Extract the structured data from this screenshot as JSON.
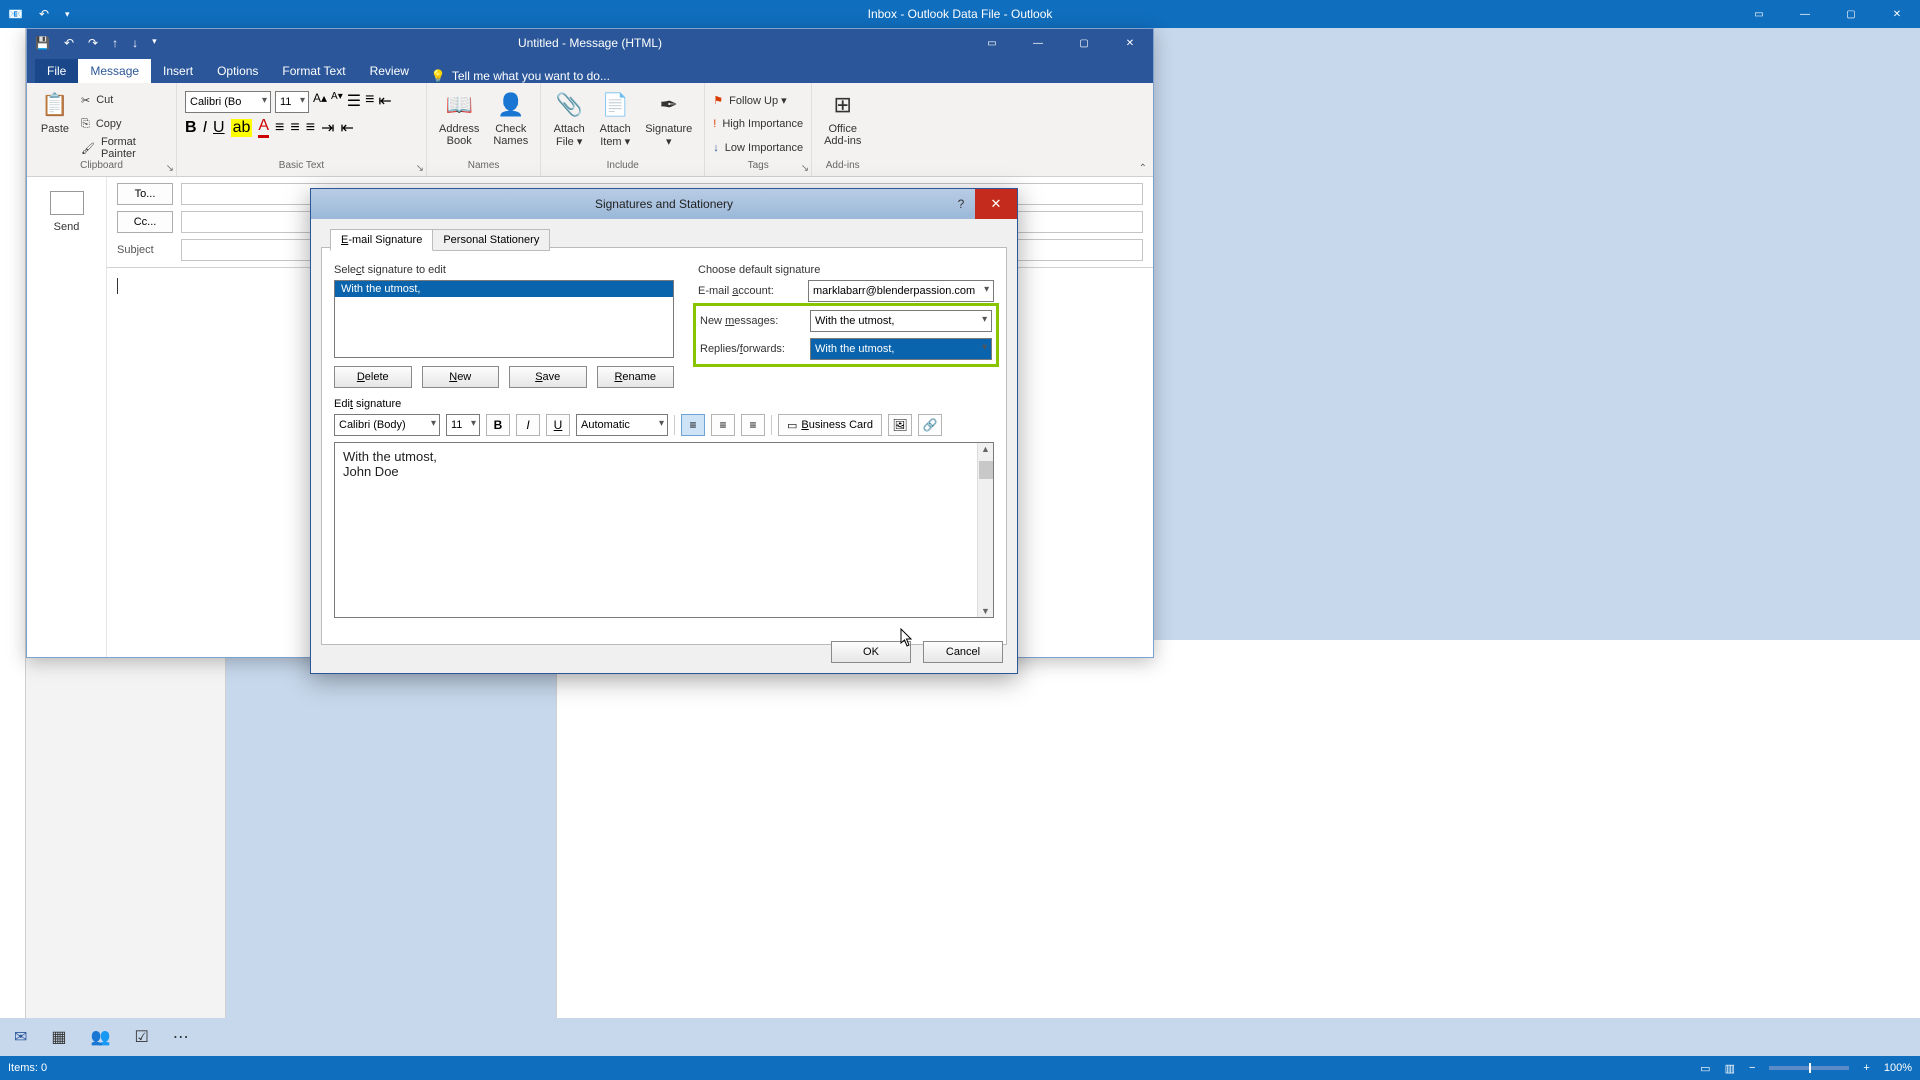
{
  "main_window": {
    "title": "Inbox - Outlook Data File - Outlook",
    "status_items": "Items: 0",
    "zoom": "100%"
  },
  "msg_window": {
    "title": "Untitled - Message (HTML)",
    "tabs": {
      "file": "File",
      "message": "Message",
      "insert": "Insert",
      "options": "Options",
      "format": "Format Text",
      "review": "Review",
      "tell": "Tell me what you want to do..."
    },
    "ribbon": {
      "paste": "Paste",
      "cut": "Cut",
      "copy": "Copy",
      "fmt_painter": "Format Painter",
      "clipboard": "Clipboard",
      "basic_text": "Basic Text",
      "names": "Names",
      "include": "Include",
      "tags": "Tags",
      "addins": "Add-ins",
      "font": "Calibri (Bo",
      "size": "11",
      "addr_book": "Address\nBook",
      "check_names": "Check\nNames",
      "attach_file": "Attach\nFile ▾",
      "attach_item": "Attach\nItem ▾",
      "signature": "Signature\n▾",
      "follow_up": "Follow Up ▾",
      "high_imp": "High Importance",
      "low_imp": "Low Importance",
      "office_addins": "Office\nAdd-ins"
    },
    "compose": {
      "send": "Send",
      "to": "To...",
      "cc": "Cc...",
      "subject": "Subject"
    }
  },
  "dialog": {
    "title": "Signatures and Stationery",
    "tabs": {
      "email": "E-mail Signature",
      "personal": "Personal Stationery"
    },
    "select_label": "Select signature to edit",
    "choose_label": "Choose default signature",
    "sig_list": [
      "With the utmost,"
    ],
    "defaults": {
      "email_account_label": "E-mail account:",
      "email_account": "marklabarr@blenderpassion.com",
      "new_msg_label": "New messages:",
      "new_msg": "With the utmost,",
      "replies_label": "Replies/forwards:",
      "replies": "With the utmost,"
    },
    "btns": {
      "delete": "Delete",
      "new": "New",
      "save": "Save",
      "rename": "Rename",
      "ok": "OK",
      "cancel": "Cancel"
    },
    "edit_label": "Edit signature",
    "edit_toolbar": {
      "font": "Calibri (Body)",
      "size": "11",
      "color": "Automatic",
      "bizcard": "Business Card"
    },
    "edit_text_l1": "With the utmost,",
    "edit_text_l2": "John Doe"
  }
}
